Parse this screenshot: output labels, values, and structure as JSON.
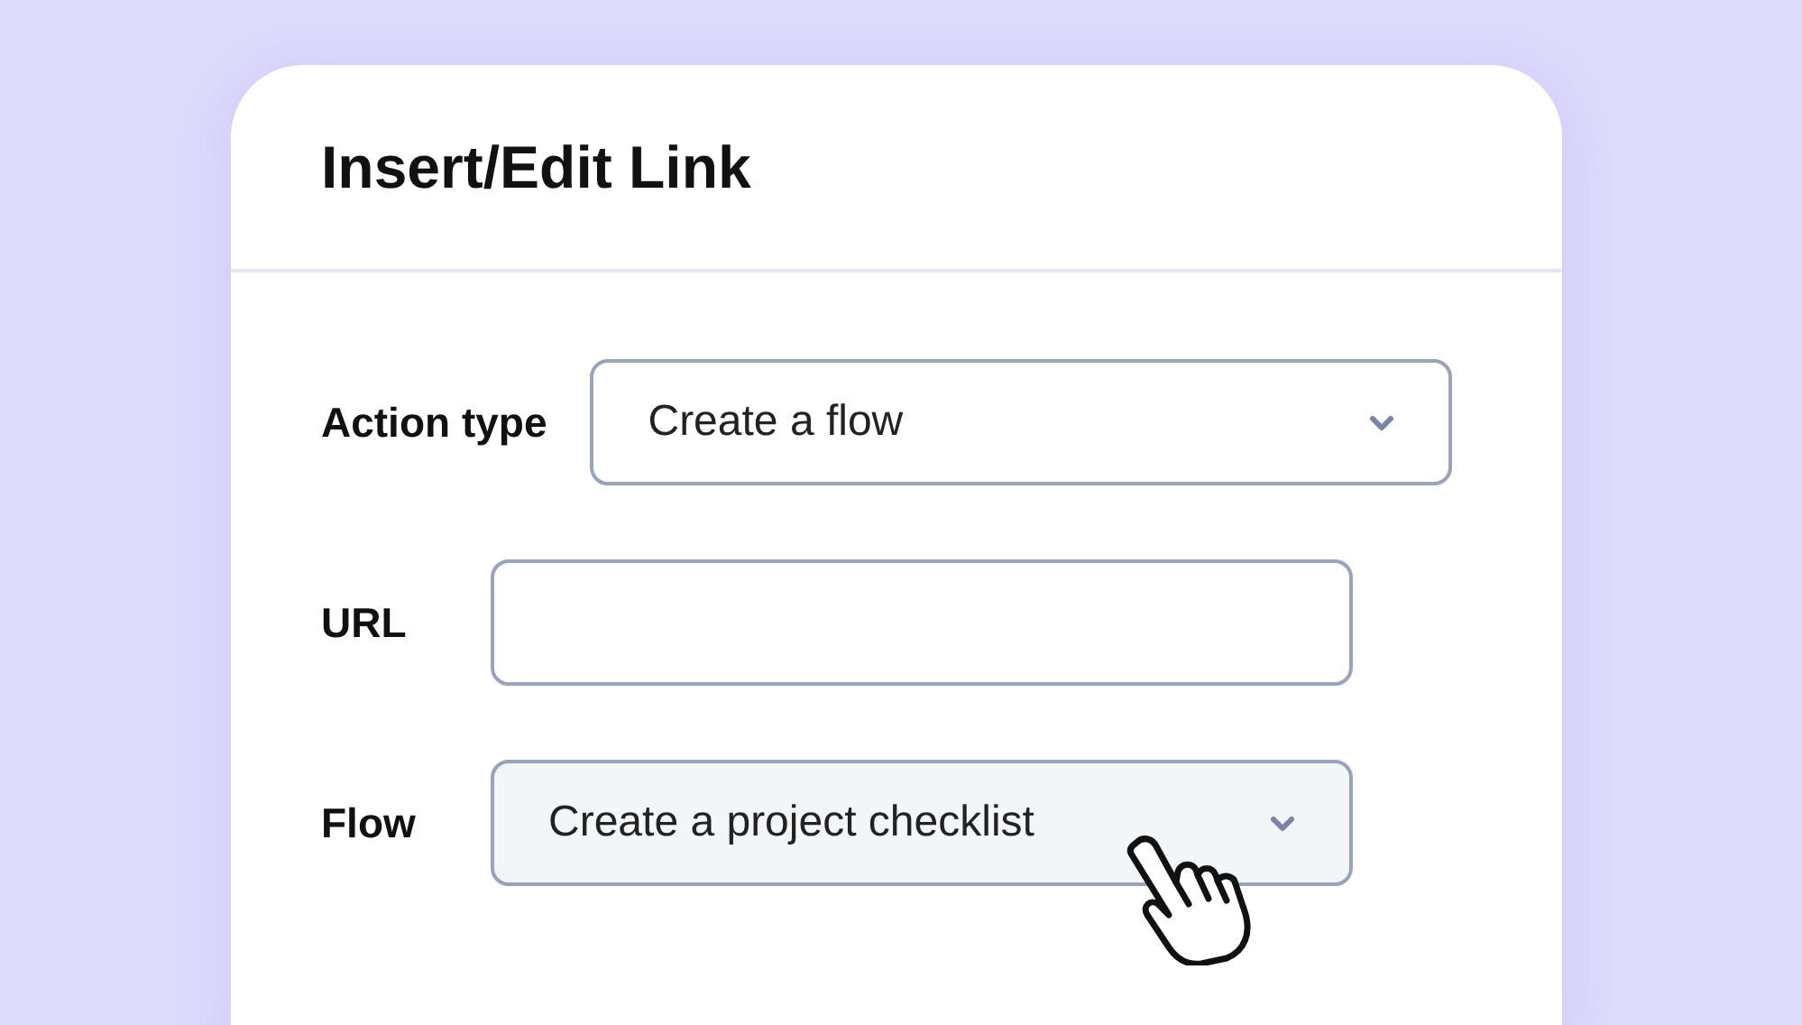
{
  "dialog": {
    "title": "Insert/Edit Link"
  },
  "fields": [
    {
      "kind": "select",
      "label": "Action type",
      "value": "Create a flow",
      "hovered": false
    },
    {
      "kind": "text",
      "label": "URL"
    },
    {
      "kind": "select",
      "label": "Flow",
      "value": "Create a project checklist",
      "hovered": true
    }
  ]
}
